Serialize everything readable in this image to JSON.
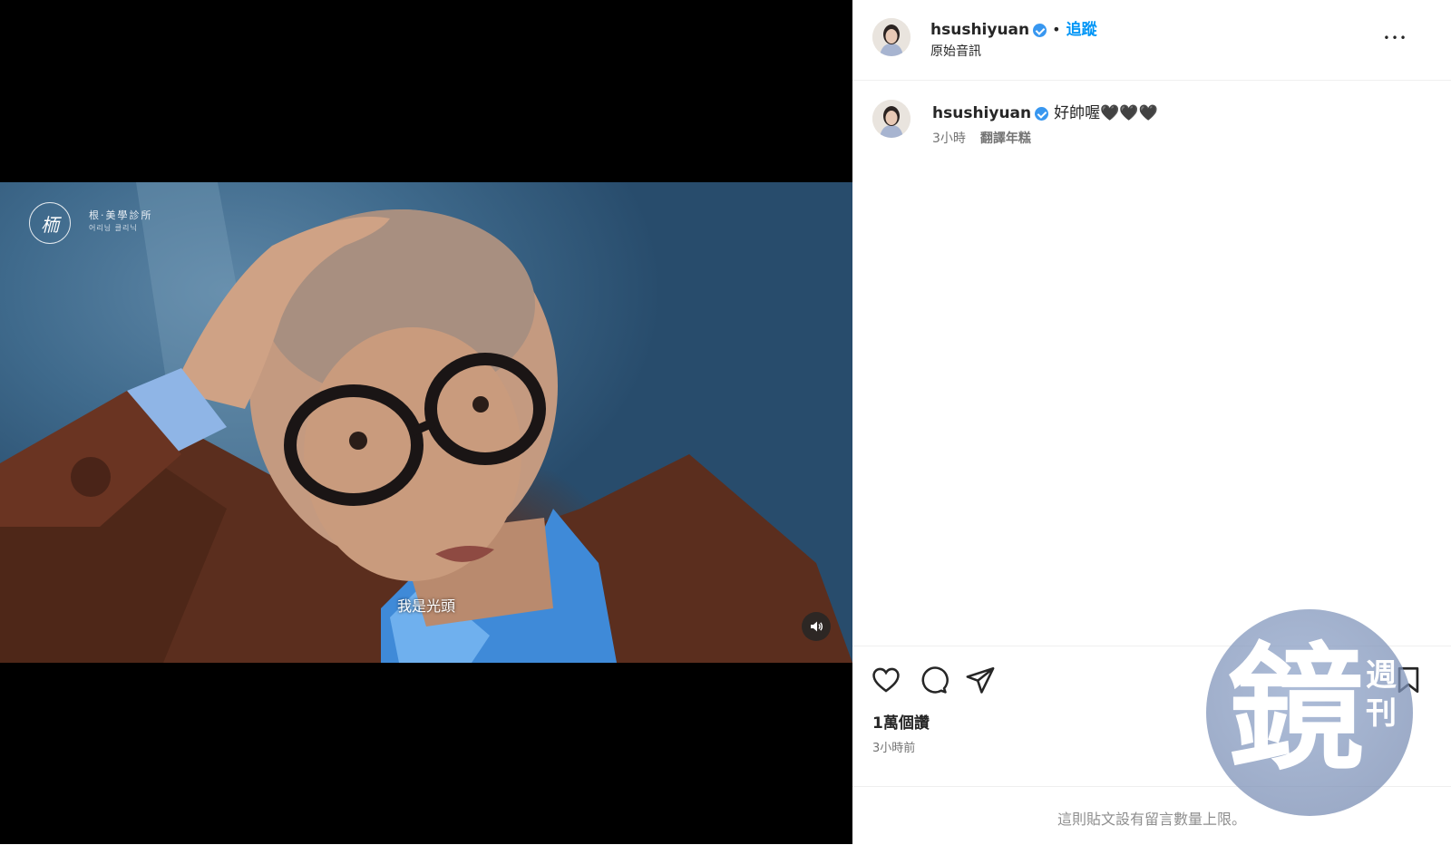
{
  "video": {
    "clinic_name": "根·美學診所",
    "clinic_subtitle": "어리닝 클리닉",
    "clinic_logo_text": "栭",
    "subtitle": "我是光頭",
    "mute_icon": "volume-icon"
  },
  "header": {
    "username": "hsushiyuan",
    "separator": "•",
    "follow_label": "追蹤",
    "audio_label": "原始音訊",
    "more_label": "•••"
  },
  "caption": {
    "username": "hsushiyuan",
    "text": "好帥喔🖤🖤🖤",
    "time": "3小時",
    "translate_label": "翻譯年糕"
  },
  "actions": {
    "likes": "1萬個讚",
    "posted": "3小時前",
    "icons": [
      "heart-icon",
      "comment-icon",
      "share-icon",
      "bookmark-icon"
    ]
  },
  "comment_limit": "這則貼文設有留言數量上限。",
  "watermark": {
    "main_char": "鏡",
    "side_chars": "週刊"
  },
  "colors": {
    "link_blue": "#0095f6",
    "verified_blue": "#3897f0",
    "muted_text": "#737373"
  }
}
